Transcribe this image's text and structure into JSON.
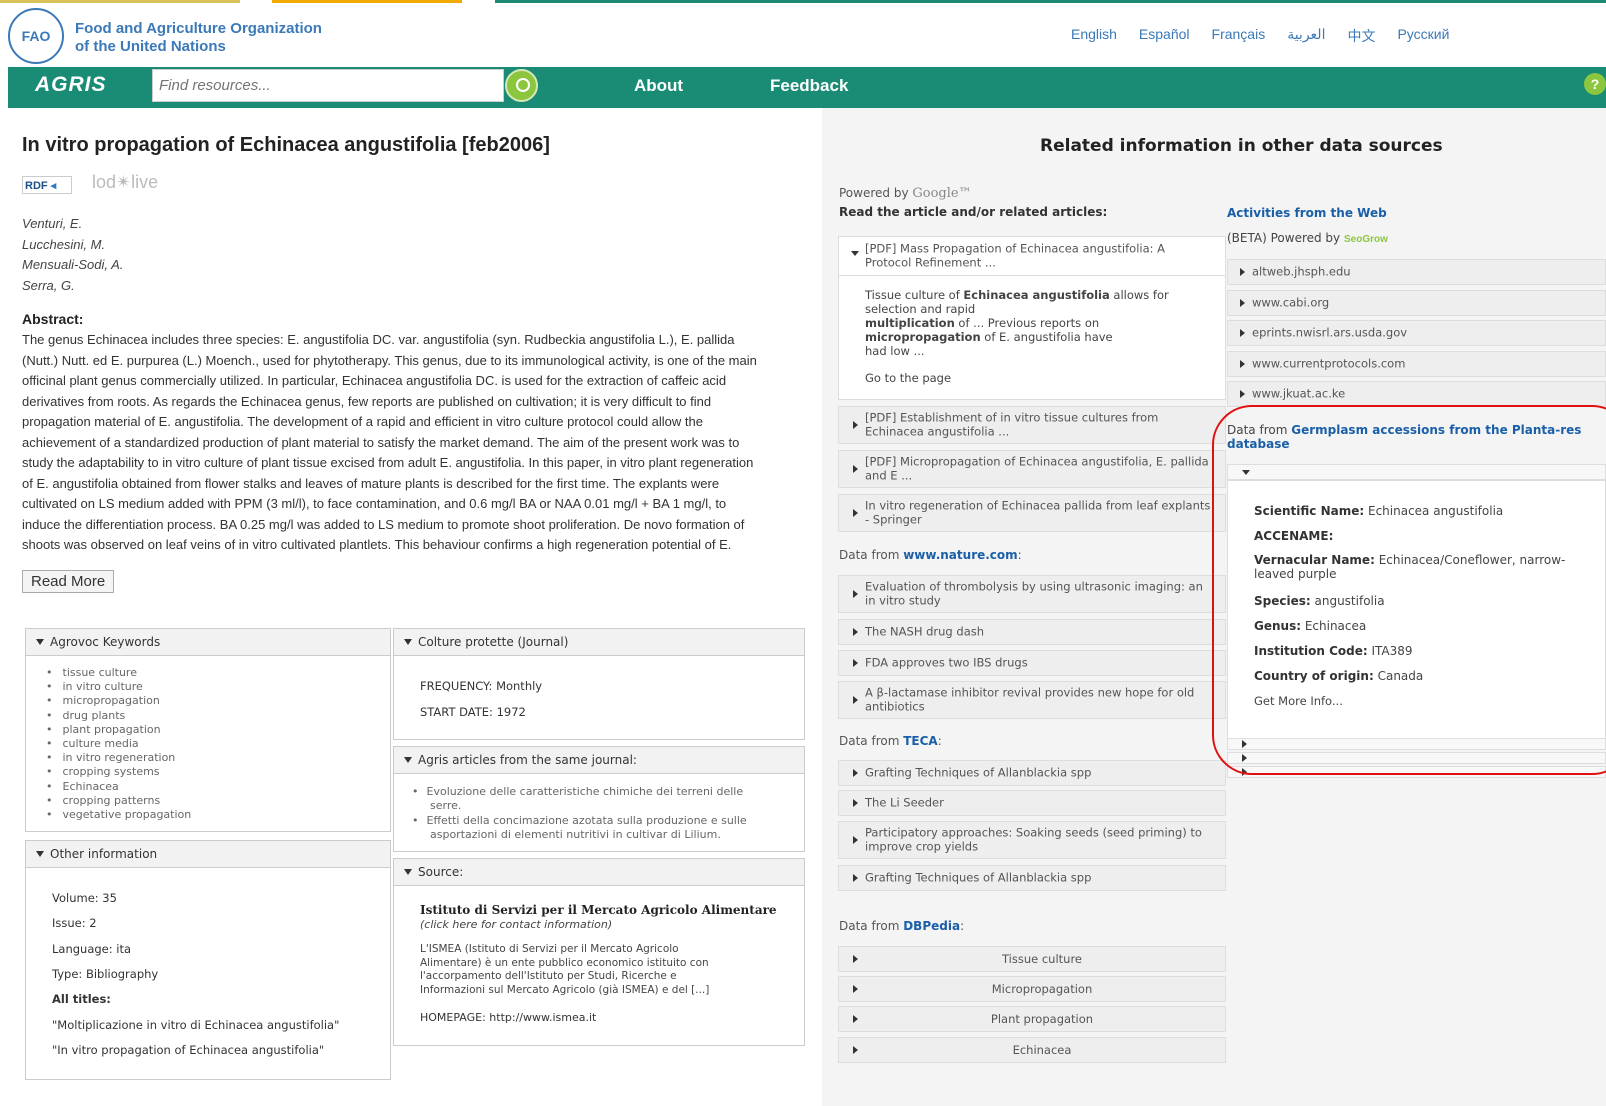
{
  "header": {
    "org_line1": "Food and Agriculture Organization",
    "org_line2": "of the United Nations",
    "logo_text": "FAO",
    "languages": [
      "English",
      "Español",
      "Français",
      "العربية",
      "中文",
      "Русский"
    ]
  },
  "nav": {
    "brand": "AGRIS",
    "search_placeholder": "Find resources...",
    "about": "About",
    "feedback": "Feedback",
    "help": "?"
  },
  "record": {
    "title": "In vitro propagation of Echinacea angustifolia  [feb2006]",
    "rdf": "RDF",
    "lodlive": "lod✴live",
    "authors": [
      "Venturi, E.",
      "Lucchesini, M.",
      "Mensuali-Sodi, A.",
      "Serra, G."
    ],
    "abstract_label": "Abstract:",
    "abstract_lines": [
      "The genus Echinacea includes three species: E. angustifolia DC. var. angustifolia (syn. Rudbeckia angustifolia L.), E. pallida",
      "(Nutt.) Nutt. ed E. purpurea (L.) Moench., used for phytotherapy. This genus, due to its immunological activity, is one of the main",
      "officinal plant genus commercially utilized. In particular, Echinacea angustifolia DC. is used for the extraction of caffeic acid",
      "derivatives from roots. As regards the Echinacea genus, few reports are published on cultivation; it is very difficult to find",
      "propagation material of E. angustifolia. The development of a rapid and efficient in vitro culture protocol could allow the",
      "achievement of a standardized production of plant material to satisfy the market demand. The aim of the present work was to",
      "study the adaptability to in vitro culture of plant tissue excised from adult E. angustifolia. In this paper, in vitro plant regeneration",
      "of E. angustifolia obtained from flower stalks and leaves of mature plants is described for the first time. The explants were",
      "cultivated on LS medium added with PPM (3 ml/l), to face contamination, and 0.6 mg/l BA or NAA 0.01 mg/l + BA 1 mg/l, to",
      "induce the differentiation process. BA 0.25 mg/l was added to LS medium to promote shoot proliferation. De novo formation of",
      "shoots was observed on leaf veins of in vitro cultivated plantlets. This behaviour confirms a high regeneration potential of E."
    ],
    "read_more": "Read More"
  },
  "agrovoc": {
    "header": "Agrovoc Keywords",
    "items": [
      "tissue culture",
      "in vitro culture",
      "micropropagation",
      "drug plants",
      "plant propagation",
      "culture media",
      "in vitro regeneration",
      "cropping systems",
      "Echinacea",
      "cropping patterns",
      "vegetative propagation"
    ]
  },
  "other_info": {
    "header": "Other information",
    "volume": "Volume: 35",
    "issue": "Issue: 2",
    "language": "Language: ita",
    "type": "Type: Bibliography",
    "all_titles_label": "All titles:",
    "titles": [
      "\"Moltiplicazione in vitro di Echinacea angustifolia\"",
      "\"In vitro propagation of Echinacea angustifolia\""
    ]
  },
  "journal": {
    "header": "Colture protette (Journal)",
    "frequency": "FREQUENCY: Monthly",
    "start_date": "START DATE: 1972"
  },
  "same_journal": {
    "header": "Agris articles from the same journal:",
    "items": [
      [
        "Evoluzione delle caratteristiche chimiche dei terreni delle",
        "serre."
      ],
      [
        "Effetti della concimazione azotata sulla produzione e sulle",
        "asportazioni di elementi nutritivi in cultivar di Lilium."
      ]
    ]
  },
  "source": {
    "header": "Source:",
    "name": "Istituto di Servizi per il Mercato Agricolo Alimentare",
    "contact": "(click here for contact information)",
    "desc": [
      "L'ISMEA (Istituto di Servizi per il Mercato Agricolo",
      "Alimentare) è un ente pubblico economico istituito con",
      "l'accorpamento dell'Istituto per Studi, Ricerche e",
      "Informazioni sul Mercato Agricolo (già ISMEA) e del [...]"
    ],
    "homepage": "HOMEPAGE: http://www.ismea.it"
  },
  "related": {
    "title": "Related information in other data sources",
    "powered_by": "Powered by",
    "google": "Google™",
    "read_label": "Read the article and/or related articles:",
    "google_items": [
      [
        "[PDF] Mass Propagation of Echinacea angustifolia: A",
        "Protocol Refinement ..."
      ],
      [
        "[PDF] Establishment of in vitro tissue cultures from",
        "Echinacea angustifolia ..."
      ],
      [
        "[PDF] Micropropagation of Echinacea angustifolia, E. pallida",
        "and E ..."
      ],
      [
        "In vitro regeneration of Echinacea pallida from leaf explants",
        "- Springer"
      ]
    ],
    "expanded": {
      "l1a": "Tissue culture of ",
      "l1b": "Echinacea angustifolia",
      "l1c": " allows for",
      "l2": "selection and rapid",
      "l3a": "multiplication",
      "l3b": " of ... Previous reports on",
      "l4a": "micropropagation",
      "l4b": " of E. angustifolia have",
      "l5": "had low ...",
      "goto": "Go to the page"
    },
    "nature_label": "Data from ",
    "nature_link": "www.nature.com",
    "nature_items": [
      [
        "Evaluation of thrombolysis by using ultrasonic imaging: an",
        "in vitro study"
      ],
      [
        "The NASH drug dash"
      ],
      [
        "FDA approves two IBS drugs"
      ],
      [
        "A β-lactamase inhibitor revival provides new hope for old",
        "antibiotics"
      ]
    ],
    "teca_label": "Data from ",
    "teca_link": "TECA",
    "teca_items": [
      [
        "Grafting Techniques of Allanblackia spp"
      ],
      [
        "The Li Seeder"
      ],
      [
        "Participatory approaches: Soaking seeds (seed priming) to",
        "improve crop yields"
      ],
      [
        "Grafting Techniques of Allanblackia spp"
      ]
    ],
    "dbpedia_label": "Data from ",
    "dbpedia_link": "DBPedia",
    "dbpedia_items": [
      "Tissue culture",
      "Micropropagation",
      "Plant propagation",
      "Echinacea"
    ]
  },
  "web": {
    "title": "Activities from the Web",
    "beta": "(BETA) Powered by",
    "seo": "SeoGrow",
    "items": [
      "altweb.jhsph.edu",
      "www.cabi.org",
      "eprints.nwisrl.ars.usda.gov",
      "www.currentprotocols.com",
      "www.jkuat.ac.ke"
    ]
  },
  "germplasm": {
    "label": "Data from ",
    "link1": "Germplasm accessions from the Planta-res",
    "link2": "database",
    "sci_label": "Scientific Name:",
    "sci": " Echinacea angustifolia",
    "acc_label": "ACCENAME:",
    "vern_label": "Vernacular Name:",
    "vern1": " Echinacea/Coneflower, narrow-",
    "vern2": "leaved purple",
    "species_label": "Species:",
    "species": " angustifolia",
    "genus_label": "Genus:",
    "genus": " Echinacea",
    "inst_label": "Institution Code:",
    "inst": " ITA389",
    "country_label": "Country of origin:",
    "country": " Canada",
    "more": "Get More Info..."
  },
  "colors": {
    "nav_green": "#1a8c75",
    "link_blue": "#1a5fa8",
    "highlight_red": "#e01010",
    "search_green": "#8cc63f"
  }
}
